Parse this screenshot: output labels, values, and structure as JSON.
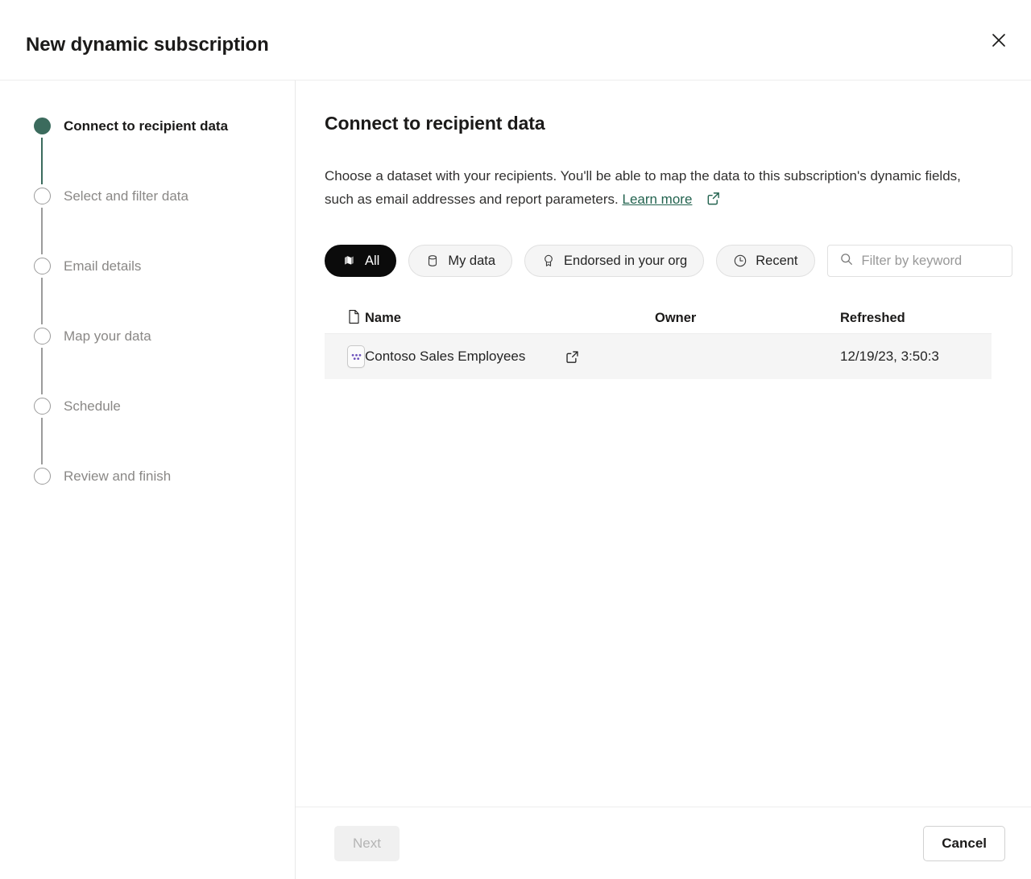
{
  "dialog": {
    "title": "New dynamic subscription",
    "close_label": "Close",
    "close_icon": "close-icon"
  },
  "sidebar": {
    "steps": [
      {
        "label": "Connect to recipient data",
        "state": "current"
      },
      {
        "label": "Select and filter data",
        "state": "pending"
      },
      {
        "label": "Email details",
        "state": "pending"
      },
      {
        "label": "Map your data",
        "state": "pending"
      },
      {
        "label": "Schedule",
        "state": "pending"
      },
      {
        "label": "Review and finish",
        "state": "pending"
      }
    ]
  },
  "main": {
    "heading": "Connect to recipient data",
    "description": "Choose a dataset with your recipients. You'll be able to map the data to this subscription's dynamic fields, such as email addresses and report parameters.",
    "learn_more_label": "Learn more",
    "learn_more_icon": "external-link-icon"
  },
  "filters": {
    "pills": [
      {
        "label": "All",
        "icon": "layers-stack-icon",
        "selected": true
      },
      {
        "label": "My data",
        "icon": "database-icon",
        "selected": false
      },
      {
        "label": "Endorsed in your org",
        "icon": "certified-badge-icon",
        "selected": false
      },
      {
        "label": "Recent",
        "icon": "clock-icon",
        "selected": false
      }
    ],
    "search": {
      "placeholder": "Filter by keyword",
      "value": "",
      "icon": "search-icon"
    }
  },
  "table": {
    "columns": {
      "type_icon": "file-icon",
      "name": "Name",
      "owner": "Owner",
      "refreshed": "Refreshed"
    },
    "rows": [
      {
        "icon": "dataset-icon",
        "name": "Contoso Sales Employees",
        "open_icon": "external-link-icon",
        "owner": "",
        "refreshed": "12/19/23, 3:50:3"
      }
    ]
  },
  "footer": {
    "next_label": "Next",
    "cancel_label": "Cancel"
  },
  "colors": {
    "accent_green": "#3b6b5d",
    "link_green": "#23634f",
    "pill_selected_bg": "#0b0b0b",
    "row_hover_bg": "#f5f5f5",
    "dataset_icon_purple": "#6b4fbb",
    "step_pending": "#8a8886"
  }
}
